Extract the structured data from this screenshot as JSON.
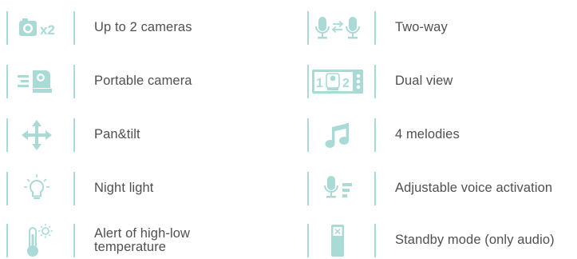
{
  "colors": {
    "icon_teal": "#a9dad6",
    "icon_teal_dark": "#8fd0cb",
    "divider": "#a9dad6",
    "text": "#505050"
  },
  "features": {
    "left": [
      {
        "icon": "camera-x2-icon",
        "label": "Up to 2 cameras"
      },
      {
        "icon": "portable-camera-icon",
        "label": "Portable camera"
      },
      {
        "icon": "pan-tilt-arrows-icon",
        "label": "Pan&tilt"
      },
      {
        "icon": "night-light-bulb-icon",
        "label": "Night light"
      },
      {
        "icon": "thermometer-alert-icon",
        "label": "Alert of high-low temperature"
      }
    ],
    "right": [
      {
        "icon": "two-way-microphones-icon",
        "label": "Two-way"
      },
      {
        "icon": "dual-view-screen-icon",
        "label": "Dual view"
      },
      {
        "icon": "music-note-icon",
        "label": "4 melodies"
      },
      {
        "icon": "voice-activation-mic-icon",
        "label": "Adjustable voice activation"
      },
      {
        "icon": "standby-device-icon",
        "label": "Standby mode (only audio)"
      }
    ]
  },
  "icon_texts": {
    "camera_multiplier": "x2",
    "dual_view_one": "1",
    "dual_view_two": "2"
  }
}
